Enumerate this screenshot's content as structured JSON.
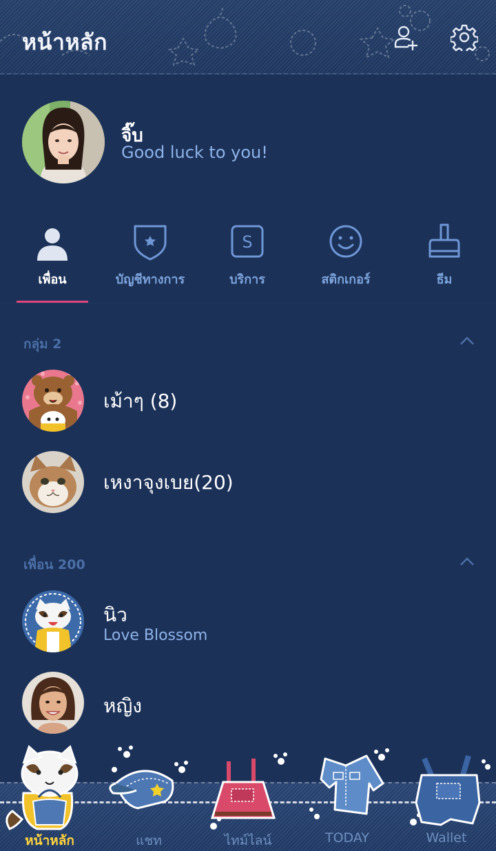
{
  "header": {
    "title": "หน้าหลัก",
    "add_friend_icon": "add-friend-icon",
    "settings_icon": "gear-icon"
  },
  "profile": {
    "name": "จิ๊บ",
    "status_message": "Good luck to you!"
  },
  "tabs": [
    {
      "label": "เพื่อน",
      "icon": "person-icon",
      "active": true
    },
    {
      "label": "บัญชีทางการ",
      "icon": "shield-star-icon",
      "active": false
    },
    {
      "label": "บริการ",
      "icon": "service-s-icon",
      "active": false
    },
    {
      "label": "สติกเกอร์",
      "icon": "smiley-icon",
      "active": false
    },
    {
      "label": "ธีม",
      "icon": "brush-icon",
      "active": false
    }
  ],
  "groups_section": {
    "title": "กลุ่ม 2",
    "items": [
      {
        "name": "เม้าๆ (8)"
      },
      {
        "name": "เหงาจุงเบย(20)"
      }
    ]
  },
  "friends_section": {
    "title": "เพื่อน 200",
    "items": [
      {
        "name": "นิว",
        "status": "Love Blossom"
      },
      {
        "name": "หญิง",
        "status": ""
      }
    ]
  },
  "bottom_nav": [
    {
      "label": "หน้าหลัก",
      "icon": "raccoon-icon",
      "active": true
    },
    {
      "label": "แชท",
      "icon": "cap-icon",
      "active": false
    },
    {
      "label": "ไทม์ไลน์",
      "icon": "overalls-dress-icon",
      "active": false
    },
    {
      "label": "TODAY",
      "icon": "denim-jacket-icon",
      "active": false
    },
    {
      "label": "Wallet",
      "icon": "denim-overalls-icon",
      "active": false
    }
  ],
  "colors": {
    "background": "#1b3158",
    "accent_underline": "#e0457b",
    "status_text": "#8fb3e8",
    "active_nav_label": "#ffd43b"
  }
}
